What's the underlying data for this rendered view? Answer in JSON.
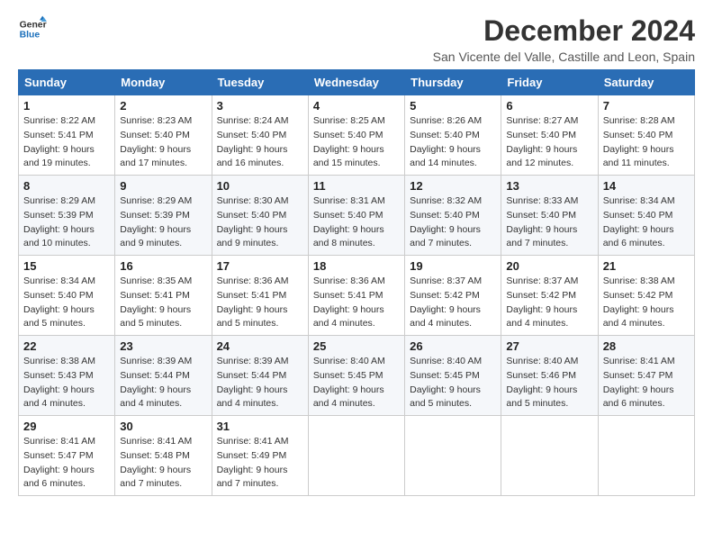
{
  "logo": {
    "line1": "General",
    "line2": "Blue"
  },
  "title": "December 2024",
  "subtitle": "San Vicente del Valle, Castille and Leon, Spain",
  "headers": [
    "Sunday",
    "Monday",
    "Tuesday",
    "Wednesday",
    "Thursday",
    "Friday",
    "Saturday"
  ],
  "weeks": [
    [
      {
        "day": "1",
        "sunrise": "8:22 AM",
        "sunset": "5:41 PM",
        "daylight": "9 hours and 19 minutes."
      },
      {
        "day": "2",
        "sunrise": "8:23 AM",
        "sunset": "5:40 PM",
        "daylight": "9 hours and 17 minutes."
      },
      {
        "day": "3",
        "sunrise": "8:24 AM",
        "sunset": "5:40 PM",
        "daylight": "9 hours and 16 minutes."
      },
      {
        "day": "4",
        "sunrise": "8:25 AM",
        "sunset": "5:40 PM",
        "daylight": "9 hours and 15 minutes."
      },
      {
        "day": "5",
        "sunrise": "8:26 AM",
        "sunset": "5:40 PM",
        "daylight": "9 hours and 14 minutes."
      },
      {
        "day": "6",
        "sunrise": "8:27 AM",
        "sunset": "5:40 PM",
        "daylight": "9 hours and 12 minutes."
      },
      {
        "day": "7",
        "sunrise": "8:28 AM",
        "sunset": "5:40 PM",
        "daylight": "9 hours and 11 minutes."
      }
    ],
    [
      {
        "day": "8",
        "sunrise": "8:29 AM",
        "sunset": "5:39 PM",
        "daylight": "9 hours and 10 minutes."
      },
      {
        "day": "9",
        "sunrise": "8:29 AM",
        "sunset": "5:39 PM",
        "daylight": "9 hours and 9 minutes."
      },
      {
        "day": "10",
        "sunrise": "8:30 AM",
        "sunset": "5:40 PM",
        "daylight": "9 hours and 9 minutes."
      },
      {
        "day": "11",
        "sunrise": "8:31 AM",
        "sunset": "5:40 PM",
        "daylight": "9 hours and 8 minutes."
      },
      {
        "day": "12",
        "sunrise": "8:32 AM",
        "sunset": "5:40 PM",
        "daylight": "9 hours and 7 minutes."
      },
      {
        "day": "13",
        "sunrise": "8:33 AM",
        "sunset": "5:40 PM",
        "daylight": "9 hours and 7 minutes."
      },
      {
        "day": "14",
        "sunrise": "8:34 AM",
        "sunset": "5:40 PM",
        "daylight": "9 hours and 6 minutes."
      }
    ],
    [
      {
        "day": "15",
        "sunrise": "8:34 AM",
        "sunset": "5:40 PM",
        "daylight": "9 hours and 5 minutes."
      },
      {
        "day": "16",
        "sunrise": "8:35 AM",
        "sunset": "5:41 PM",
        "daylight": "9 hours and 5 minutes."
      },
      {
        "day": "17",
        "sunrise": "8:36 AM",
        "sunset": "5:41 PM",
        "daylight": "9 hours and 5 minutes."
      },
      {
        "day": "18",
        "sunrise": "8:36 AM",
        "sunset": "5:41 PM",
        "daylight": "9 hours and 4 minutes."
      },
      {
        "day": "19",
        "sunrise": "8:37 AM",
        "sunset": "5:42 PM",
        "daylight": "9 hours and 4 minutes."
      },
      {
        "day": "20",
        "sunrise": "8:37 AM",
        "sunset": "5:42 PM",
        "daylight": "9 hours and 4 minutes."
      },
      {
        "day": "21",
        "sunrise": "8:38 AM",
        "sunset": "5:42 PM",
        "daylight": "9 hours and 4 minutes."
      }
    ],
    [
      {
        "day": "22",
        "sunrise": "8:38 AM",
        "sunset": "5:43 PM",
        "daylight": "9 hours and 4 minutes."
      },
      {
        "day": "23",
        "sunrise": "8:39 AM",
        "sunset": "5:44 PM",
        "daylight": "9 hours and 4 minutes."
      },
      {
        "day": "24",
        "sunrise": "8:39 AM",
        "sunset": "5:44 PM",
        "daylight": "9 hours and 4 minutes."
      },
      {
        "day": "25",
        "sunrise": "8:40 AM",
        "sunset": "5:45 PM",
        "daylight": "9 hours and 4 minutes."
      },
      {
        "day": "26",
        "sunrise": "8:40 AM",
        "sunset": "5:45 PM",
        "daylight": "9 hours and 5 minutes."
      },
      {
        "day": "27",
        "sunrise": "8:40 AM",
        "sunset": "5:46 PM",
        "daylight": "9 hours and 5 minutes."
      },
      {
        "day": "28",
        "sunrise": "8:41 AM",
        "sunset": "5:47 PM",
        "daylight": "9 hours and 6 minutes."
      }
    ],
    [
      {
        "day": "29",
        "sunrise": "8:41 AM",
        "sunset": "5:47 PM",
        "daylight": "9 hours and 6 minutes."
      },
      {
        "day": "30",
        "sunrise": "8:41 AM",
        "sunset": "5:48 PM",
        "daylight": "9 hours and 7 minutes."
      },
      {
        "day": "31",
        "sunrise": "8:41 AM",
        "sunset": "5:49 PM",
        "daylight": "9 hours and 7 minutes."
      },
      null,
      null,
      null,
      null
    ]
  ]
}
